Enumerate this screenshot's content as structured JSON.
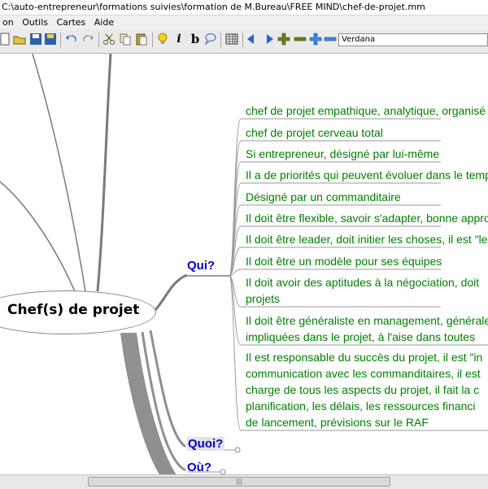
{
  "window": {
    "title": "C:\\auto-entrepreneur\\formations suivies\\formation de M.Bureau\\FREE MIND\\chef-de-projet.mm"
  },
  "menu": [
    "on",
    "Outils",
    "Cartes",
    "Aide"
  ],
  "toolbar": {
    "font": "Verdana",
    "italic_label": "i",
    "bold_label": "b"
  },
  "mindmap": {
    "root": "Chef(s) de projet",
    "branches": [
      "Qui?",
      "Quoi?",
      "Où?"
    ],
    "qui_children": [
      [
        "chef de projet empathique, analytique, organisé"
      ],
      [
        "chef de projet cerveau total"
      ],
      [
        "Si entrepreneur, désigné par lui-même"
      ],
      [
        "Il a de priorités qui peuvent évoluer dans le temps"
      ],
      [
        "Désigné par un commanditaire"
      ],
      [
        "Il doit être flexible, savoir s'adapter, bonne approche"
      ],
      [
        "Il doit être leader, doit initier les choses, il est \"le"
      ],
      [
        "Il doit être un modèle pour ses équipes"
      ],
      [
        "Il doit avoir des aptitudes à la négociation, doit",
        "projets"
      ],
      [
        "Il doit être généraliste en management, générale",
        "impliquées dans le projet, à l'aise dans toutes"
      ],
      [
        "Il est responsable du succès du projet, il est \"in",
        "communication avec les commanditaires, il est",
        "charge de tous les aspects du projet, il fait la c",
        "planification, les délais, les ressources financi",
        "de lancement, prévisions sur le RAF"
      ]
    ]
  },
  "scrollbar": {
    "grip": "|||"
  }
}
